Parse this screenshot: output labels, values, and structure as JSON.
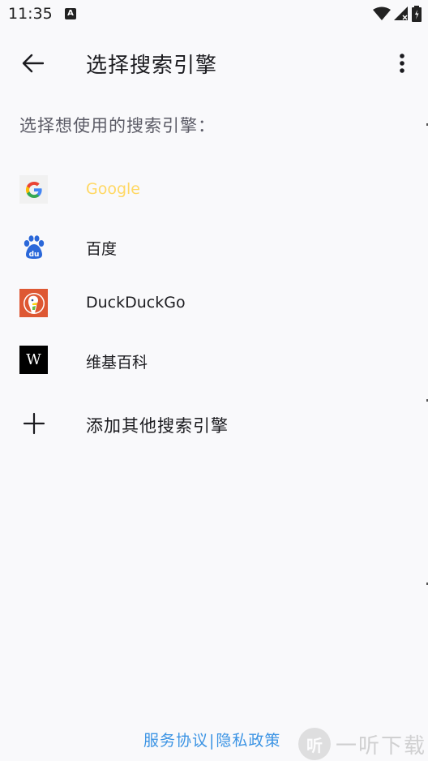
{
  "status_bar": {
    "time": "11:35",
    "notification_icon": "text-a-icon",
    "icons": [
      "wifi-icon",
      "signal-icon",
      "battery-icon"
    ]
  },
  "app_bar": {
    "back_icon": "arrow-left-icon",
    "title": "选择搜索引擎",
    "menu_icon": "more-vert-icon"
  },
  "section_label": "选择想使用的搜索引擎：",
  "engines": [
    {
      "label": "Google",
      "icon": "google-icon",
      "selected": true
    },
    {
      "label": "百度",
      "icon": "baidu-icon",
      "selected": false
    },
    {
      "label": "DuckDuckGo",
      "icon": "duckduckgo-icon",
      "selected": false
    },
    {
      "label": "维基百科",
      "icon": "wikipedia-icon",
      "selected": false
    }
  ],
  "add_engine": {
    "icon": "plus-icon",
    "label": "添加其他搜索引擎"
  },
  "footer": {
    "terms": "服务协议",
    "separator": "|",
    "privacy": "隐私政策"
  },
  "watermark": {
    "badge": "听",
    "text": "一听下载"
  },
  "colors": {
    "background": "#f9f9fb",
    "selected_text": "#ffd864",
    "link": "#3c94e4"
  }
}
